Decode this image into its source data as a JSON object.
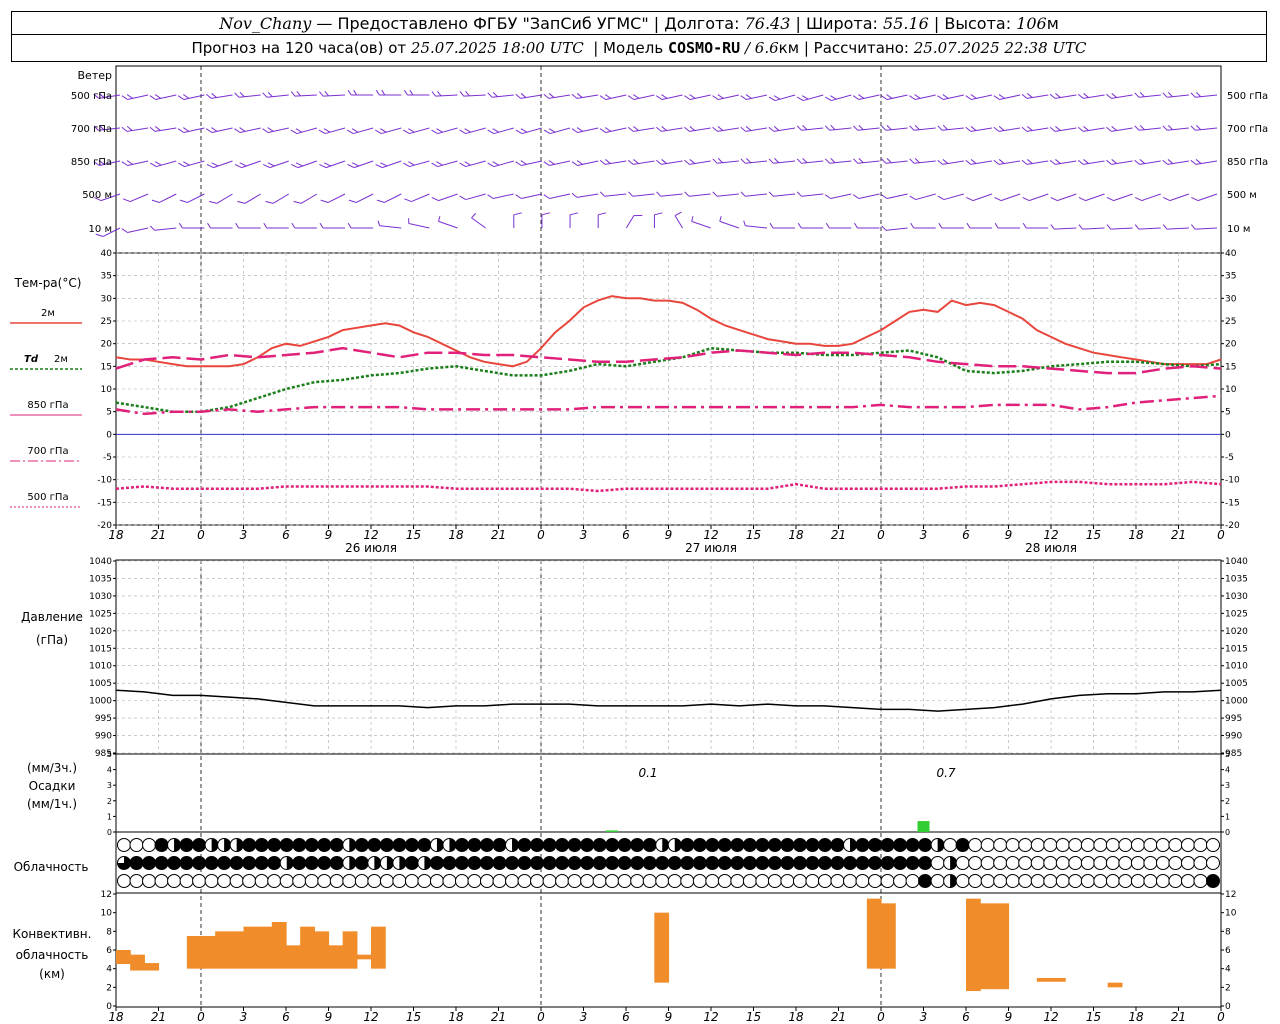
{
  "header": {
    "station": "Nov_Chany",
    "provider": " — Предоставлено ФГБУ \"ЗапСиб УГМС\" | Долгота: ",
    "lon": "76.43",
    "lat_label": " | Широта: ",
    "lat": "55.16",
    "alt_label": " | Высота: ",
    "alt": "106",
    "alt_unit": "м",
    "forecast_label": "Прогноз на 120 часа(ов) от ",
    "forecast_from": "25.07.2025 18:00 UTC",
    "model_label": "  | Модель ",
    "model": "COSMO-RU",
    "res": " / 6.6",
    "res_unit": "км",
    "calc_label": " | Рассчитано: ",
    "calc_time": "25.07.2025 22:38 UTC"
  },
  "labels": {
    "wind": "Ветер",
    "wind_levels": [
      "500 гПа",
      "700 гПа",
      "850 гПа",
      "500 м",
      "10 м"
    ],
    "temp": "Тем-ра(°C)",
    "t2m": "2м",
    "td": "Td",
    "td2m": "2м",
    "t850": "850 гПа",
    "t700": "700 гПа",
    "t500": "500 гПа",
    "pressure": "Давление",
    "pressure_unit": "(гПа)",
    "precip_3h": "(мм/3ч.)",
    "precip": "Осадки",
    "precip_1h": "(мм/1ч.)",
    "cloud": "Облачность",
    "conv1": "Конвективн.",
    "conv2": "облачность",
    "conv3": "(км)"
  },
  "colors": {
    "t2m": "#e8463c",
    "td": "#1a7f1a",
    "upper": "#e0207a",
    "wind": "#7a2fd0",
    "precip": "#33cc33",
    "conv": "#f08c2a",
    "zero": "#3333cc"
  },
  "chart_data": {
    "type": "meteogram",
    "time_axis": {
      "hour_ticks": [
        "18",
        "21",
        "0",
        "3",
        "6",
        "9",
        "12",
        "15",
        "18",
        "21",
        "0",
        "3",
        "6",
        "9",
        "12",
        "15",
        "18",
        "21",
        "0",
        "3",
        "6",
        "9",
        "12",
        "15",
        "18",
        "21",
        "0"
      ],
      "day_labels": [
        "26 июля",
        "27 июля",
        "28 июля"
      ]
    },
    "temperature": {
      "ylim": [
        -20,
        40
      ],
      "yticks": [
        -20,
        -15,
        -10,
        -5,
        0,
        5,
        10,
        15,
        20,
        25,
        30,
        35,
        40
      ],
      "series": [
        {
          "name": "2м",
          "style": "solid",
          "color": "#e8463c",
          "x": [
            0,
            1,
            2,
            3,
            4,
            5,
            6,
            7,
            8,
            9,
            10,
            11,
            12,
            13,
            14,
            15,
            16,
            17,
            18,
            19,
            20,
            21,
            22,
            23,
            24,
            25,
            26,
            27,
            28,
            29,
            30,
            31,
            32,
            33,
            34,
            35,
            36,
            37,
            38,
            39,
            40,
            41,
            42,
            43,
            44,
            45,
            46,
            47,
            48,
            49,
            50,
            51,
            52,
            53,
            54,
            55,
            56,
            57,
            58,
            59,
            60,
            61,
            62,
            63,
            64,
            65,
            66,
            67,
            68,
            69,
            70,
            71,
            72,
            73,
            74,
            75,
            76,
            77,
            78
          ],
          "y": [
            17,
            16.5,
            16.5,
            16,
            15.5,
            15,
            15,
            15,
            15,
            15.5,
            17,
            19,
            20,
            19.5,
            20.5,
            21.5,
            23,
            23.5,
            24,
            24.5,
            24,
            22.5,
            21.5,
            20,
            18.5,
            17,
            16,
            15.5,
            15,
            16,
            19,
            22.5,
            25,
            28,
            29.5,
            30.5,
            30,
            30,
            29.5,
            29.5,
            29,
            27.5,
            25.5,
            24,
            23,
            22,
            21,
            20.5,
            20,
            20,
            19.5,
            19.5,
            20,
            21.5,
            23,
            25,
            27,
            27.5,
            27,
            29.5,
            28.5,
            29,
            28.5,
            27,
            25.5,
            23,
            21.5,
            20,
            19,
            18,
            17.5,
            17,
            16.5,
            16,
            15.5,
            15.5,
            15.5,
            15.5,
            16.5
          ]
        },
        {
          "name": "Td 2м",
          "style": "dotted",
          "color": "#1a7f1a",
          "x": [
            0,
            2,
            4,
            6,
            8,
            10,
            12,
            14,
            16,
            18,
            20,
            22,
            24,
            26,
            28,
            30,
            32,
            34,
            36,
            38,
            40,
            42,
            44,
            46,
            48,
            50,
            52,
            54,
            56,
            58,
            60,
            62,
            64,
            66,
            68,
            70,
            72,
            74,
            76,
            78
          ],
          "y": [
            7,
            6,
            5,
            5,
            6,
            8,
            10,
            11.5,
            12,
            13,
            13.5,
            14.5,
            15,
            14,
            13,
            13,
            14,
            15.5,
            15,
            16,
            17,
            19,
            18.5,
            18,
            18,
            17.5,
            17.5,
            18,
            18.5,
            17,
            14,
            13.5,
            14,
            15,
            15.5,
            16,
            16,
            15.5,
            15,
            15.5
          ]
        },
        {
          "name": "850 гПа",
          "style": "long-dash",
          "color": "#e0207a",
          "x": [
            0,
            2,
            4,
            6,
            8,
            10,
            12,
            14,
            16,
            18,
            20,
            22,
            24,
            26,
            28,
            30,
            32,
            34,
            36,
            38,
            40,
            42,
            44,
            46,
            48,
            50,
            52,
            54,
            56,
            58,
            60,
            62,
            64,
            66,
            68,
            70,
            72,
            74,
            76,
            78
          ],
          "y": [
            14.5,
            16.5,
            17,
            16.5,
            17.5,
            17,
            17.5,
            18,
            19,
            18,
            17,
            18,
            18,
            17.5,
            17.5,
            17,
            16.5,
            16,
            16,
            16.5,
            17,
            18,
            18.5,
            18,
            17.5,
            18,
            18,
            17.5,
            17,
            16,
            15.5,
            15,
            15,
            14.5,
            14,
            13.5,
            13.5,
            14.5,
            15,
            14.5
          ]
        },
        {
          "name": "700 гПа",
          "style": "dash-dot",
          "color": "#e0207a",
          "x": [
            0,
            2,
            4,
            6,
            8,
            10,
            12,
            14,
            16,
            18,
            20,
            22,
            24,
            26,
            28,
            30,
            32,
            34,
            36,
            38,
            40,
            42,
            44,
            46,
            48,
            50,
            52,
            54,
            56,
            58,
            60,
            62,
            64,
            66,
            68,
            70,
            72,
            74,
            76,
            78
          ],
          "y": [
            5.5,
            4.5,
            5,
            5,
            5.5,
            5,
            5.5,
            6,
            6,
            6,
            6,
            5.5,
            5.5,
            5.5,
            5.5,
            5.5,
            5.5,
            6,
            6,
            6,
            6,
            6,
            6,
            6,
            6,
            6,
            6,
            6.5,
            6,
            6,
            6,
            6.5,
            6.5,
            6.5,
            5.5,
            6,
            7,
            7.5,
            8,
            8.5
          ]
        },
        {
          "name": "500 гПа",
          "style": "dotted",
          "color": "#e0207a",
          "x": [
            0,
            2,
            4,
            6,
            8,
            10,
            12,
            14,
            16,
            18,
            20,
            22,
            24,
            26,
            28,
            30,
            32,
            34,
            36,
            38,
            40,
            42,
            44,
            46,
            48,
            50,
            52,
            54,
            56,
            58,
            60,
            62,
            64,
            66,
            68,
            70,
            72,
            74,
            76,
            78
          ],
          "y": [
            -12,
            -11.5,
            -12,
            -12,
            -12,
            -12,
            -11.5,
            -11.5,
            -11.5,
            -11.5,
            -11.5,
            -11.5,
            -12,
            -12,
            -12,
            -12,
            -12,
            -12.5,
            -12,
            -12,
            -12,
            -12,
            -12,
            -12,
            -11,
            -12,
            -12,
            -12,
            -12,
            -12,
            -11.5,
            -11.5,
            -11,
            -10.5,
            -10.5,
            -11,
            -11,
            -11,
            -10.5,
            -11
          ]
        }
      ]
    },
    "pressure": {
      "ylim": [
        985,
        1040
      ],
      "yticks": [
        985,
        990,
        995,
        1000,
        1005,
        1010,
        1015,
        1020,
        1025,
        1030,
        1035,
        1040
      ],
      "x": [
        0,
        2,
        4,
        6,
        8,
        10,
        12,
        14,
        16,
        18,
        20,
        22,
        24,
        26,
        28,
        30,
        32,
        34,
        36,
        38,
        40,
        42,
        44,
        46,
        48,
        50,
        52,
        54,
        56,
        58,
        60,
        62,
        64,
        66,
        68,
        70,
        72,
        74,
        76,
        78
      ],
      "y": [
        1003,
        1002.5,
        1001.5,
        1001.5,
        1001,
        1000.5,
        999.5,
        998.5,
        998.5,
        998.5,
        998.5,
        998,
        998.5,
        998.5,
        999,
        999,
        999,
        998.5,
        998.5,
        998.5,
        998.5,
        999,
        998.5,
        999,
        998.5,
        998.5,
        998,
        997.5,
        997.5,
        997,
        997.5,
        998,
        999,
        1000.5,
        1001.5,
        1002,
        1002,
        1002.5,
        1002.5,
        1003
      ]
    },
    "precipitation": {
      "ylim": [
        0,
        5
      ],
      "yticks": [
        0,
        1,
        2,
        3,
        4,
        5
      ],
      "bars": [
        {
          "hour": 35,
          "value": 0.1
        },
        {
          "hour": 57,
          "value": 0.7
        }
      ],
      "labels": [
        "0.1",
        "0.7"
      ]
    },
    "cloudiness": {
      "rows": [
        "0001211222111111112111111221111211111111111221111111111111211111120100000000000000000000",
        "3111111111111211112122212111111111111111111111111111111111111111102000000000000000000000",
        "0000000000000000000000000000000000000000000000000000000000000000102000000000000000000001"
      ]
    },
    "convective": {
      "ylim": [
        0,
        12
      ],
      "yticks": [
        0,
        2,
        4,
        6,
        8,
        10,
        12
      ],
      "bars": [
        {
          "h": 0,
          "b": 4.5,
          "t": 6.0
        },
        {
          "h": 1,
          "b": 3.8,
          "t": 5.5
        },
        {
          "h": 2,
          "b": 3.8,
          "t": 4.6
        },
        {
          "h": 5,
          "b": 4.0,
          "t": 7.5
        },
        {
          "h": 6,
          "b": 4.0,
          "t": 7.5
        },
        {
          "h": 7,
          "b": 4.0,
          "t": 8.0
        },
        {
          "h": 8,
          "b": 4.0,
          "t": 8.0
        },
        {
          "h": 9,
          "b": 4.0,
          "t": 8.5
        },
        {
          "h": 10,
          "b": 4.0,
          "t": 8.5
        },
        {
          "h": 11,
          "b": 4.0,
          "t": 9.0
        },
        {
          "h": 12,
          "b": 4.0,
          "t": 6.5
        },
        {
          "h": 13,
          "b": 4.0,
          "t": 8.5
        },
        {
          "h": 14,
          "b": 4.0,
          "t": 8.0
        },
        {
          "h": 15,
          "b": 4.0,
          "t": 6.5
        },
        {
          "h": 16,
          "b": 4.0,
          "t": 8.0
        },
        {
          "h": 17,
          "b": 5.0,
          "t": 5.5
        },
        {
          "h": 18,
          "b": 4.0,
          "t": 8.5
        },
        {
          "h": 38,
          "b": 2.5,
          "t": 10.0
        },
        {
          "h": 53,
          "b": 4.0,
          "t": 11.5
        },
        {
          "h": 54,
          "b": 4.0,
          "t": 11.0
        },
        {
          "h": 60,
          "b": 1.6,
          "t": 11.5
        },
        {
          "h": 61,
          "b": 1.8,
          "t": 11.0
        },
        {
          "h": 62,
          "b": 1.8,
          "t": 11.0
        },
        {
          "h": 65,
          "b": 2.6,
          "t": 3.0
        },
        {
          "h": 66,
          "b": 2.6,
          "t": 3.0
        },
        {
          "h": 70,
          "b": 2.0,
          "t": 2.5
        }
      ]
    },
    "wind": {
      "levels": [
        "500 гПа",
        "700 гПа",
        "850 гПа",
        "500 м",
        "10 м"
      ],
      "rows": [
        {
          "dirs": [
            255,
            250,
            250,
            250,
            255,
            260,
            260,
            265,
            265,
            270,
            270,
            270,
            265,
            265,
            260,
            255,
            255,
            255,
            250,
            250,
            250,
            250,
            250,
            250,
            245,
            245,
            245,
            250,
            250,
            250,
            250,
            250,
            250,
            255,
            255,
            255,
            255,
            260,
            260,
            260
          ],
          "speed": 15
        },
        {
          "dirs": [
            260,
            255,
            255,
            250,
            250,
            250,
            250,
            245,
            245,
            245,
            245,
            245,
            245,
            245,
            245,
            245,
            245,
            250,
            250,
            255,
            255,
            255,
            255,
            255,
            255,
            260,
            260,
            260,
            260,
            260,
            260,
            255,
            255,
            255,
            255,
            255,
            255,
            260,
            260,
            260
          ],
          "speed": 10
        },
        {
          "dirs": [
            250,
            250,
            245,
            245,
            240,
            240,
            240,
            240,
            240,
            240,
            240,
            245,
            245,
            245,
            245,
            250,
            250,
            250,
            255,
            255,
            255,
            255,
            260,
            260,
            260,
            260,
            260,
            260,
            260,
            260,
            255,
            255,
            255,
            255,
            255,
            255,
            255,
            255,
            255,
            255
          ],
          "speed": 10
        },
        {
          "dirs": [
            240,
            235,
            230,
            230,
            225,
            225,
            225,
            225,
            230,
            230,
            230,
            235,
            240,
            245,
            250,
            250,
            250,
            255,
            260,
            260,
            260,
            260,
            260,
            260,
            260,
            260,
            250,
            250,
            250,
            245,
            245,
            240,
            240,
            240,
            240,
            240,
            240,
            240,
            240,
            240
          ],
          "speed": 8
        },
        {
          "dirs": [
            230,
            250,
            260,
            270,
            270,
            270,
            270,
            270,
            270,
            270,
            280,
            290,
            300,
            320,
            0,
            0,
            0,
            0,
            20,
            0,
            340,
            300,
            300,
            280,
            270,
            270,
            270,
            270,
            260,
            270,
            270,
            270,
            270,
            270,
            265,
            265,
            265,
            265,
            265,
            265
          ],
          "speed": 5
        }
      ]
    }
  }
}
